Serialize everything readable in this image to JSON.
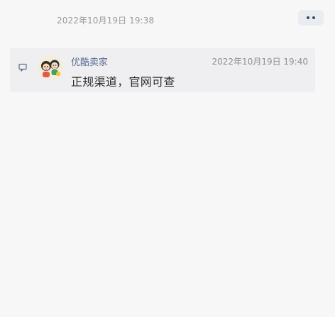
{
  "post": {
    "timestamp": "2022年10月19日 19:38"
  },
  "reply": {
    "author": "优酷卖家",
    "timestamp": "2022年10月19日 19:40",
    "text": "正规渠道，官网可查"
  },
  "icons": {
    "more": "more-dots-icon",
    "reply": "comment-bubble-icon",
    "avatar": "cartoon-avatar"
  },
  "colors": {
    "background": "#f7f7f7",
    "card": "#efeff1",
    "author": "#5a6a92",
    "more_button": "#e9ecf1"
  }
}
